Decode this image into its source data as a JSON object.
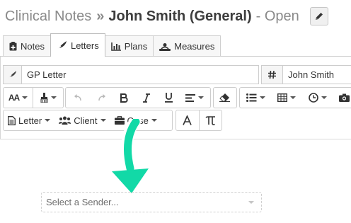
{
  "header": {
    "app_title": "Clinical Notes",
    "separator": "»",
    "client_label": "John Smith (General)",
    "status_text": "- Open",
    "edit_icon": "pencil-icon"
  },
  "tabs": [
    {
      "label": "Notes",
      "icon": "clipboard-plus-icon",
      "active": false
    },
    {
      "label": "Letters",
      "icon": "feather-icon",
      "active": true
    },
    {
      "label": "Plans",
      "icon": "bar-chart-icon",
      "active": false
    },
    {
      "label": "Measures",
      "icon": "scale-icon",
      "active": false
    }
  ],
  "subject": {
    "icon": "feather-icon",
    "value": "GP Letter"
  },
  "reference": {
    "icon": "hash-icon",
    "value": "John Smith"
  },
  "toolbar": {
    "font_size_label": "AA",
    "letter_label": "Letter",
    "client_label": "Client",
    "case_label": "Case"
  },
  "sender": {
    "placeholder": "Select a Sender..."
  },
  "colors": {
    "accent_arrow": "#12d9a7",
    "border": "#cdcdcd",
    "muted_text": "#8a8a8a"
  }
}
